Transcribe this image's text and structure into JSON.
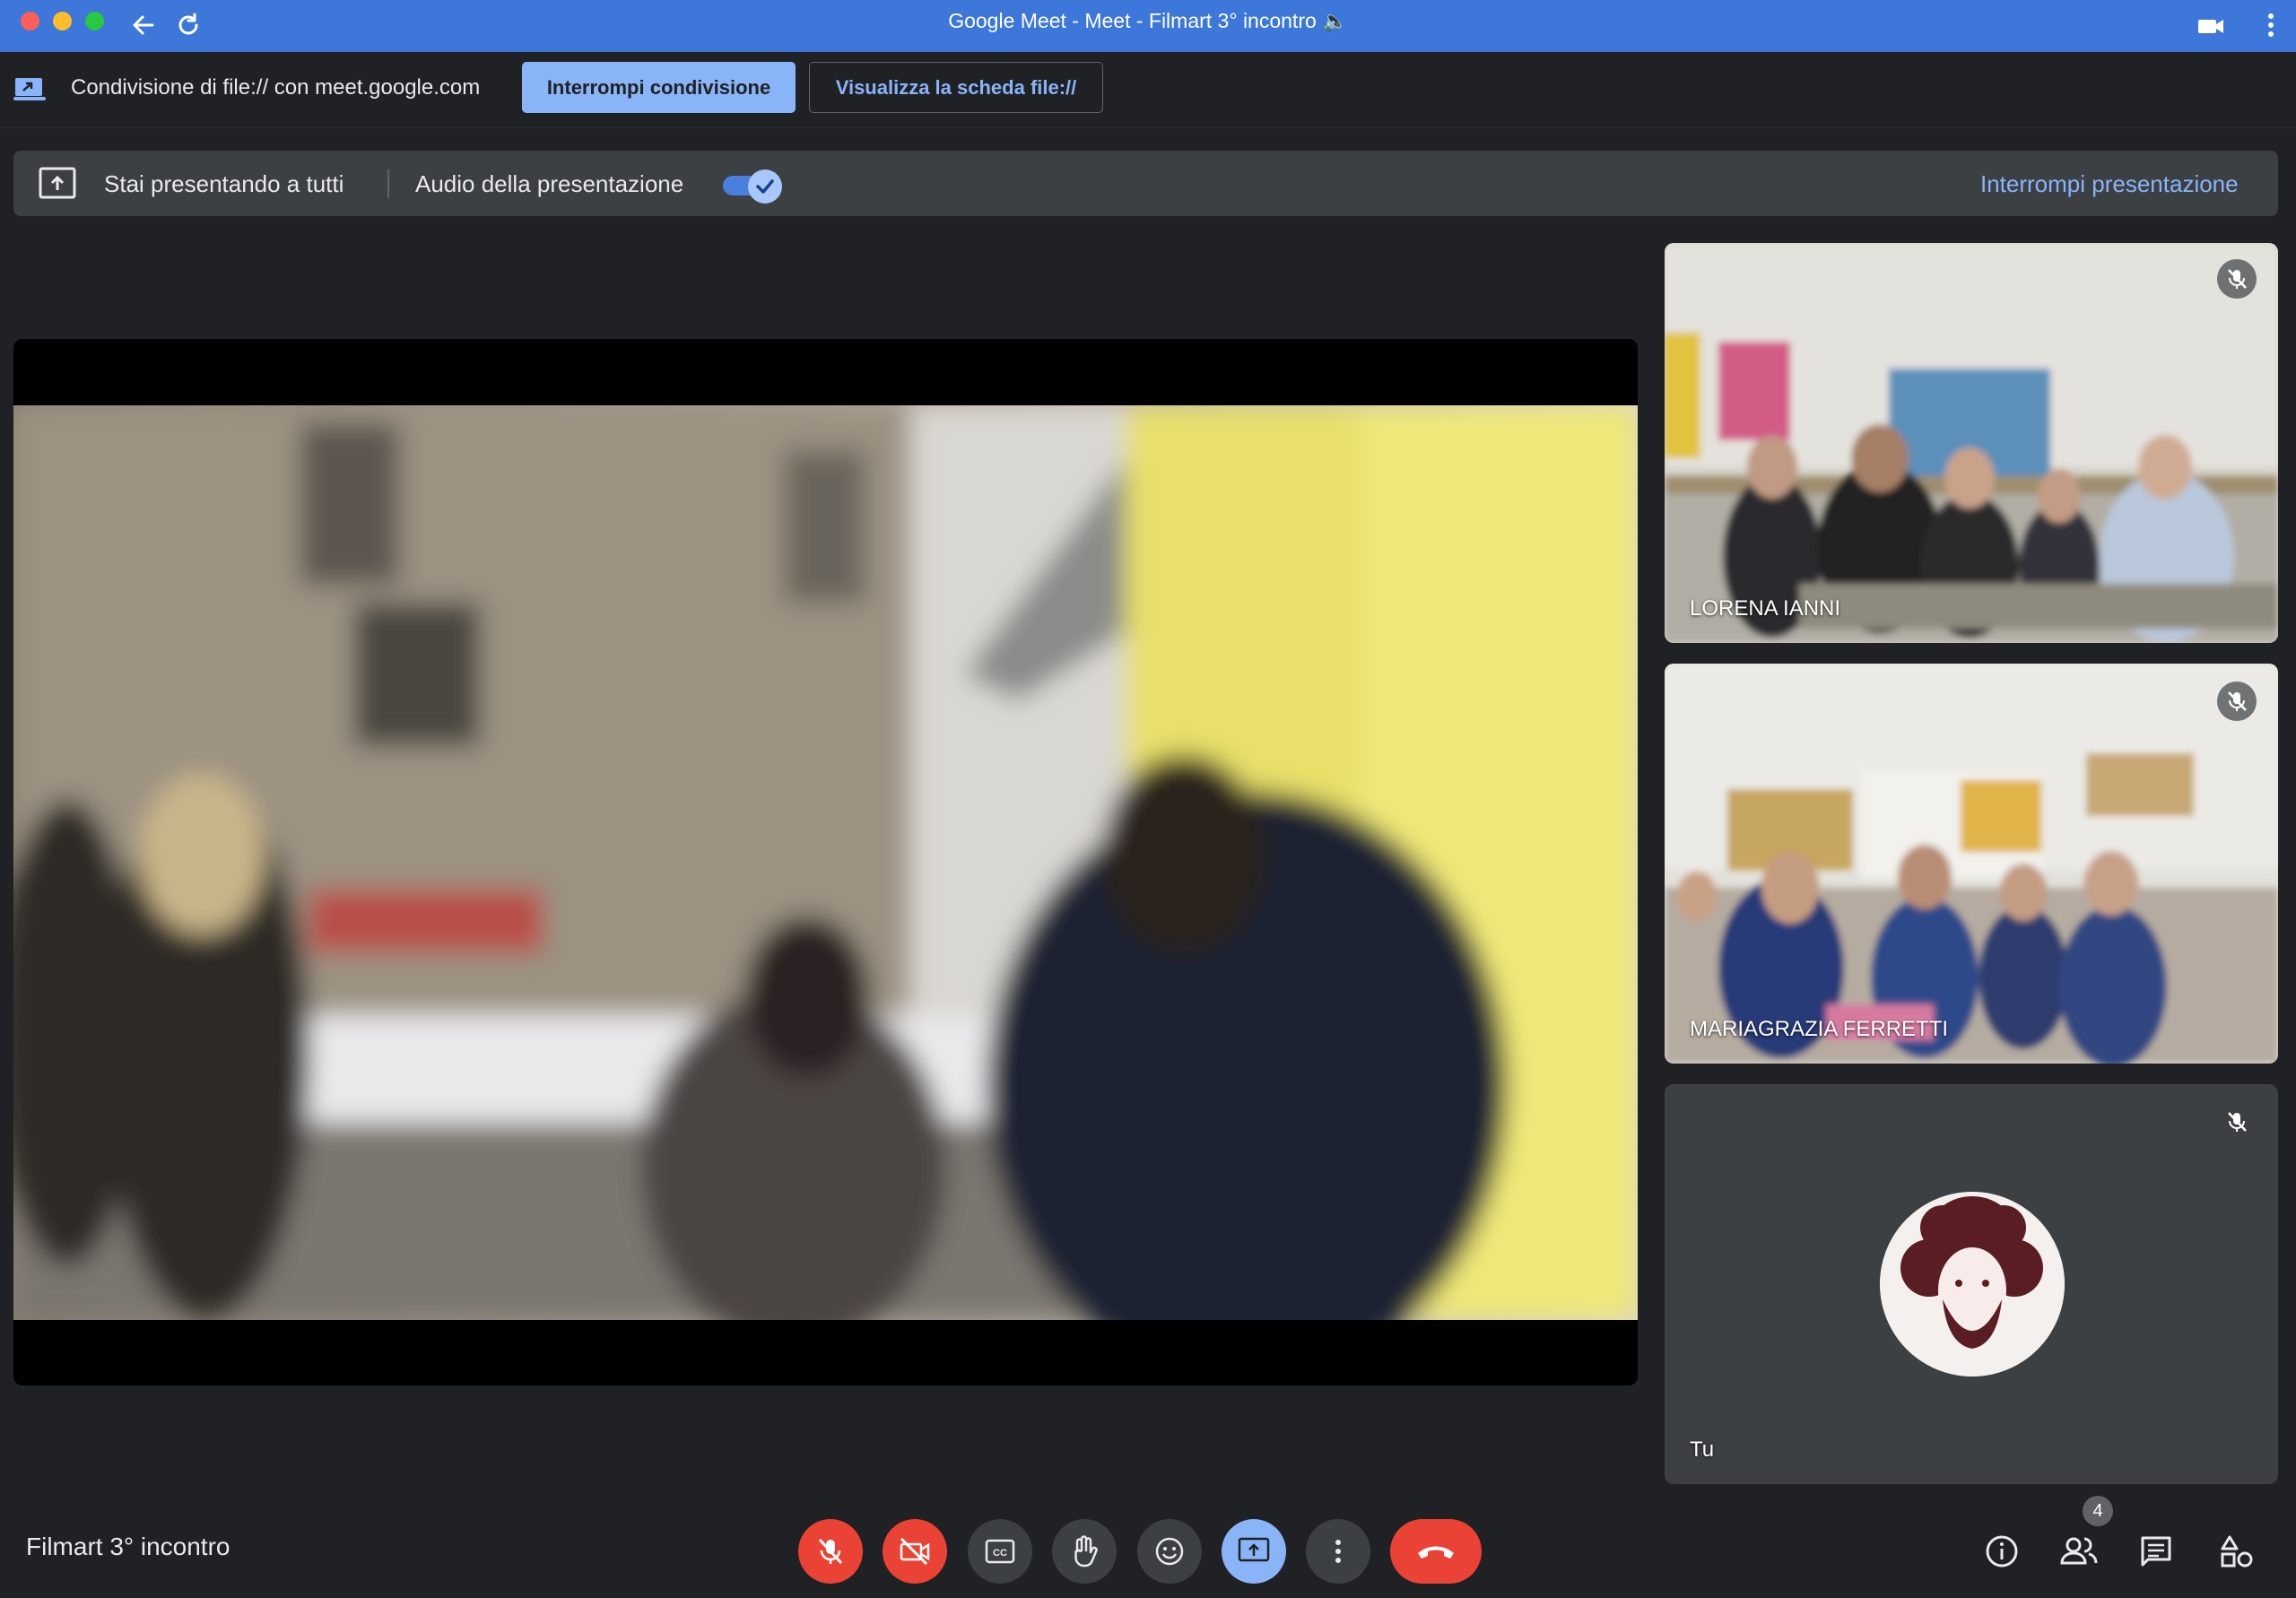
{
  "window": {
    "title": "Google Meet - Meet - Filmart 3° incontro 🔈"
  },
  "share_bar": {
    "text": "Condivisione di file:// con meet.google.com",
    "stop_sharing_label": "Interrompi condivisione",
    "view_tab_label": "Visualizza la scheda file://"
  },
  "presenting_banner": {
    "presenting_text": "Stai presentando a tutti",
    "audio_label": "Audio della presentazione",
    "audio_enabled": true,
    "stop_presenting_label": "Interrompi presentazione"
  },
  "participants": [
    {
      "name": "LORENA IANNI",
      "muted": true
    },
    {
      "name": "MARIAGRAZIA FERRETTI",
      "muted": true
    },
    {
      "name": "Tu",
      "muted": true
    }
  ],
  "bottom_bar": {
    "meeting_name": "Filmart 3° incontro",
    "controls": [
      "mic-off-icon",
      "camera-off-icon",
      "captions-icon",
      "raise-hand-icon",
      "emoji-icon",
      "present-icon",
      "more-options-icon",
      "end-call-icon"
    ],
    "people_count": "4"
  },
  "colors": {
    "title_bar": "#3c77d9",
    "background": "#202124",
    "accent": "#8ab4f8",
    "danger": "#ea4335"
  }
}
